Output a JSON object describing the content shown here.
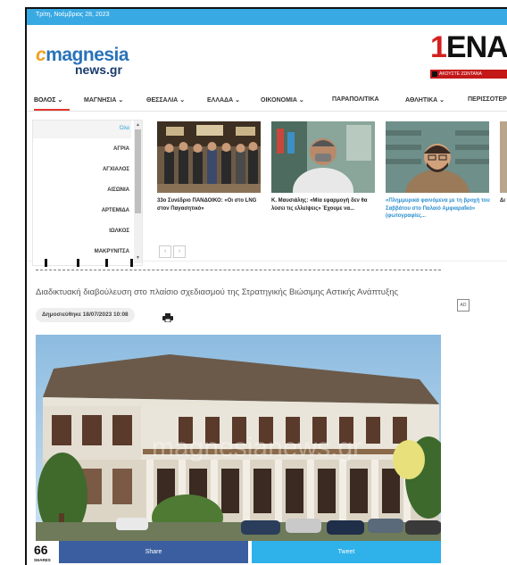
{
  "topbar": {
    "date": "Τρίτη, Νοέμβριος 28, 2023"
  },
  "logo": {
    "part1": "magnesia",
    "part2": "news.gr"
  },
  "ad_banner": {
    "brand": "ENA",
    "digit": "1",
    "tagline": "ΑΚΟΥΣΤΕ ΖΩΝΤΑΝΑ"
  },
  "nav": {
    "items": [
      "ΒΟΛΟΣ",
      "ΜΑΓΝΗΣΙΑ",
      "ΘΕΣΣΑΛΙΑ",
      "ΕΛΛΑΔΑ",
      "ΟΙΚΟΝΟΜΙΑ",
      "ΠΑΡΑΠΟΛΙΤΙΚΑ",
      "ΑΘΛΗΤΙΚΑ",
      "ΠΕΡΙΣΣΟΤΕΡ"
    ],
    "chevron": "⌄"
  },
  "dropdown": {
    "categories": [
      "Όλα",
      "ΑΓΡΙΑ",
      "ΑΓΧΙΑΛΟΣ",
      "ΑΙΣΩΝΙΑ",
      "ΑΡΤΕΜΙΔΑ",
      "ΙΩΛΚΟΣ",
      "ΜΑΚΡΥΝΙΤΣΑ"
    ],
    "cards": [
      {
        "caption": "33ο Συνέδριο ΠΑΝΔΟΙΚΟ: «Οι στο LNG στον Παγασητικό»",
        "highlight": false
      },
      {
        "caption": "Κ. Μαυσιάλης: «Μία εφαρμογή δεν θα λύσει τις ελλείψεις» Έχουμε να...",
        "highlight": false
      },
      {
        "caption": "«Πλημμυρικά φαινόμενα με τη βροχή του Σαββάτου στο Παλαιό Αμφιαραΐκό» (φωτογραφίες...",
        "highlight": true
      },
      {
        "caption": "Δι να",
        "highlight": false
      }
    ],
    "prev": "‹",
    "next": "›"
  },
  "article": {
    "headline": "Διαδικτυακή διαβούλευση στο πλαίσιο σχεδιασμού της Στρατηγικής Βιώσιμης Αστικής Ανάπτυξης",
    "published": "Δημοσιεύθηκε 18/07/2023 10:08",
    "ad_label": "AD",
    "watermark": "magnesianews.gr"
  },
  "share": {
    "count": "66",
    "count_label": "SHARES",
    "share_label": "Share",
    "tweet_label": "Tweet"
  },
  "colors": {
    "accent": "#e3362b",
    "topbar": "#39a9e3",
    "facebook": "#3b5ea0",
    "twitter": "#2fb1ea"
  }
}
